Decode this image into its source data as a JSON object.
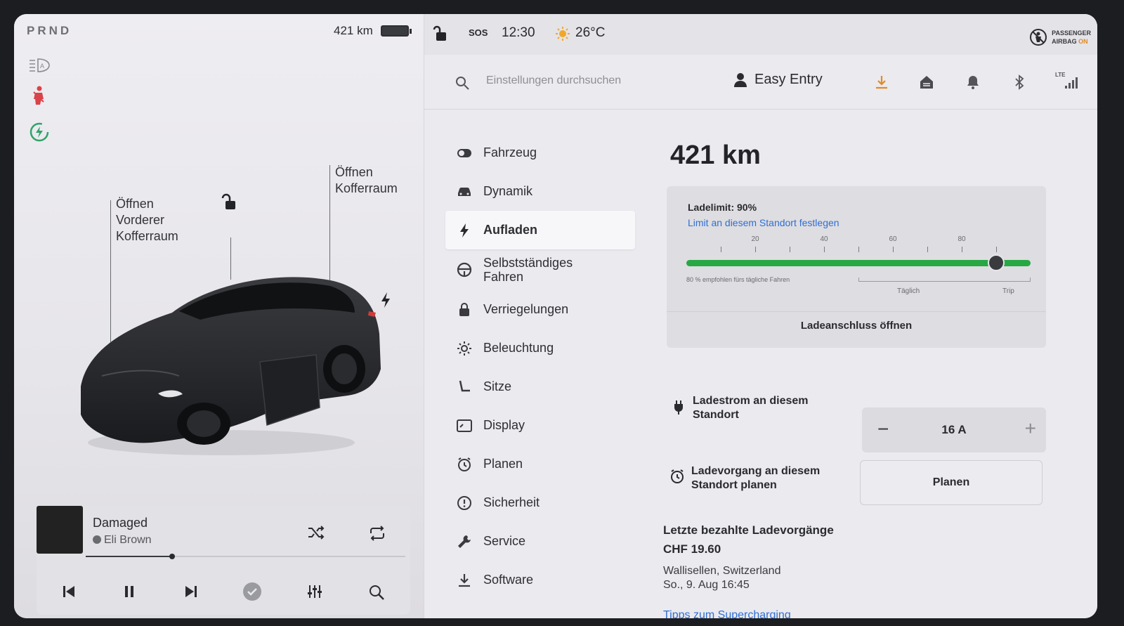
{
  "left": {
    "gear": "PRND",
    "range": "421 km",
    "labels": {
      "front_trunk": [
        "Öffnen",
        "Vorderer",
        "Kofferraum"
      ],
      "rear_trunk": [
        "Öffnen",
        "Kofferraum"
      ]
    },
    "icons": [
      "headlight-auto-icon",
      "seatbelt-warning-icon",
      "eco-charge-icon",
      "lock-open-icon",
      "charge-bolt-icon"
    ]
  },
  "media": {
    "title": "Damaged",
    "artist": "Eli Brown",
    "progress": 0.27,
    "controls": [
      "previous-icon",
      "pause-icon",
      "next-icon",
      "check-icon",
      "equalizer-icon",
      "search-icon",
      "shuffle-icon",
      "repeat-icon"
    ]
  },
  "status": {
    "sos": "SOS",
    "time": "12:30",
    "temperature": "26°C",
    "airbag_line1": "PASSENGER",
    "airbag_line2": "AIRBAG",
    "airbag_state": "ON"
  },
  "header": {
    "search_placeholder": "Einstellungen durchsuchen",
    "profile": "Easy Entry",
    "network": "LTE"
  },
  "menu": [
    {
      "label": "Fahrzeug",
      "icon": "toggle-icon"
    },
    {
      "label": "Dynamik",
      "icon": "car-icon"
    },
    {
      "label": "Aufladen",
      "icon": "bolt-icon"
    },
    {
      "label": "Selbstständiges Fahren",
      "icon": "steering-wheel-icon"
    },
    {
      "label": "Verriegelungen",
      "icon": "lock-icon"
    },
    {
      "label": "Beleuchtung",
      "icon": "light-icon"
    },
    {
      "label": "Sitze",
      "icon": "seat-icon"
    },
    {
      "label": "Display",
      "icon": "display-icon"
    },
    {
      "label": "Planen",
      "icon": "clock-icon"
    },
    {
      "label": "Sicherheit",
      "icon": "info-icon"
    },
    {
      "label": "Service",
      "icon": "wrench-icon"
    },
    {
      "label": "Software",
      "icon": "download-icon"
    }
  ],
  "charging": {
    "range": "421 km",
    "limit_label": "Ladelimit: 90%",
    "limit_value": 90,
    "limit_link": "Limit an diesem Standort festlegen",
    "ticks": [
      "20",
      "40",
      "60",
      "80"
    ],
    "note": "80 % empfohlen fürs tägliche Fahren",
    "cat_daily": "Täglich",
    "cat_trip": "Trip",
    "port_button": "Ladeanschluss öffnen",
    "current_label": "Ladestrom an diesem Standort",
    "current_value": "16 A",
    "minus": "−",
    "plus": "+",
    "schedule_label": "Ladevorgang an diesem Standort planen",
    "schedule_button": "Planen",
    "history_title": "Letzte bezahlte Ladevorgänge",
    "history_amount": "CHF 19.60",
    "history_location": "Wallisellen, Switzerland",
    "history_date": "So., 9. Aug 16:45",
    "tips_link": "Tipps zum Supercharging"
  }
}
